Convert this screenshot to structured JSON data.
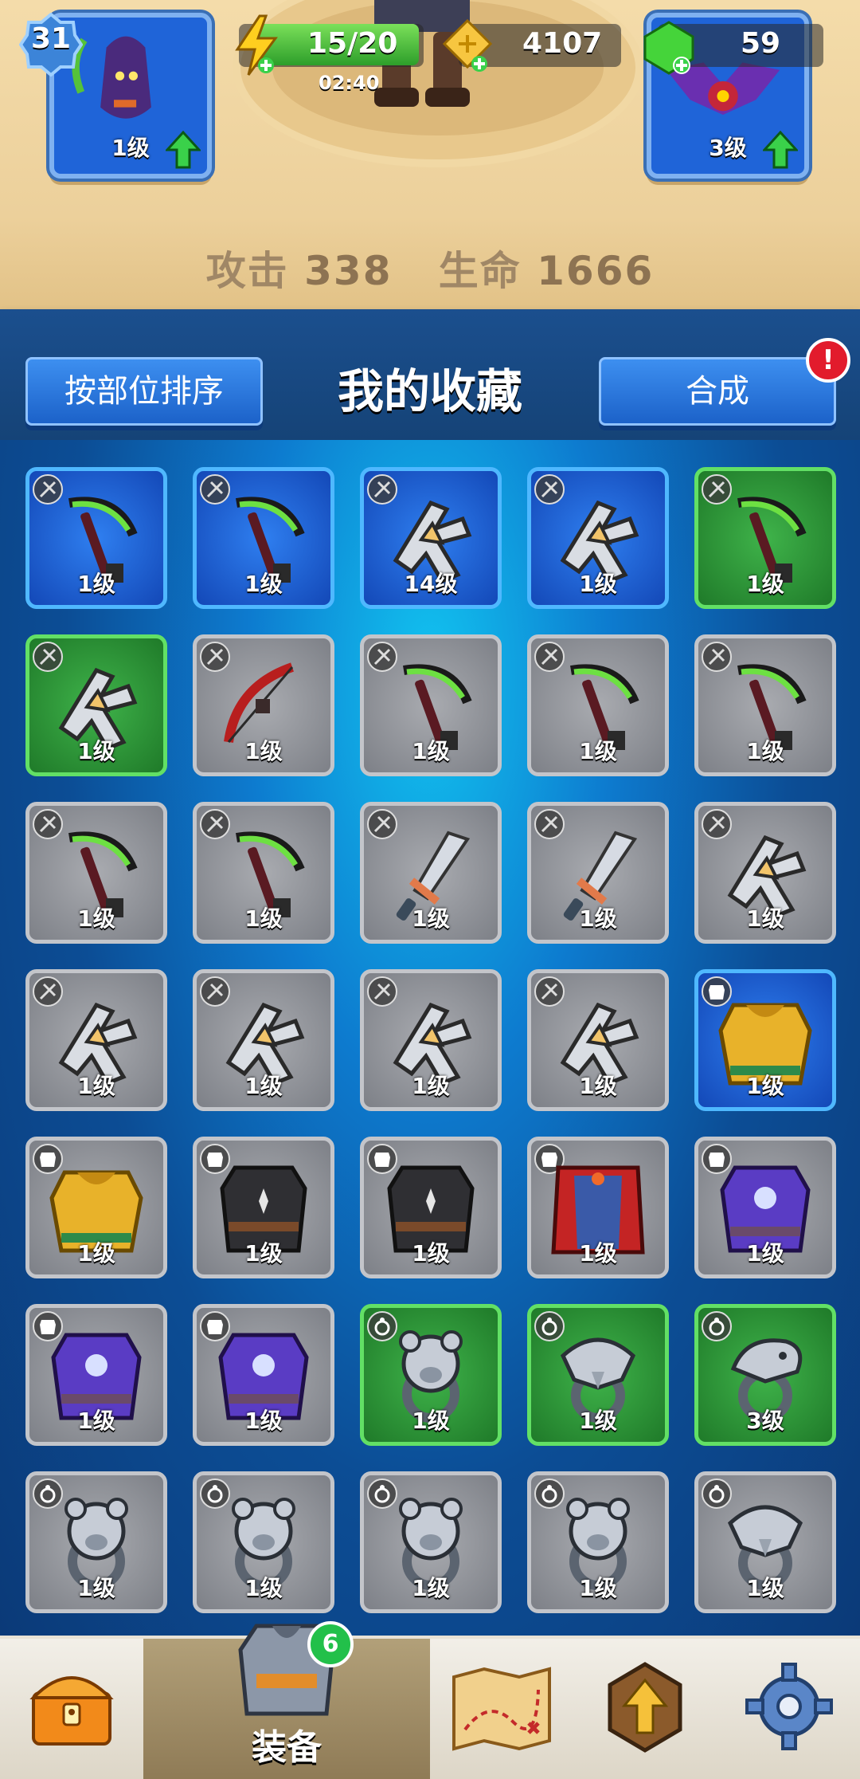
{
  "hud": {
    "player_level": "31",
    "energy": "15/20",
    "energy_timer": "02:40",
    "gold": "4107",
    "gems": "59"
  },
  "equipped": {
    "left_slot_level": "1级",
    "right_slot_level": "3级"
  },
  "stats": {
    "attack_label": "攻击",
    "attack_value": "338",
    "hp_label": "生命",
    "hp_value": "1666"
  },
  "header": {
    "sort_button": "按部位排序",
    "title": "我的收藏",
    "merge_button": "合成",
    "merge_alert": "!"
  },
  "items": [
    {
      "type": "scythe",
      "rarity": "blue",
      "category": "weapon",
      "level": "1级"
    },
    {
      "type": "scythe",
      "rarity": "blue",
      "category": "weapon",
      "level": "1级"
    },
    {
      "type": "shuriken",
      "rarity": "blue",
      "category": "weapon",
      "level": "14级"
    },
    {
      "type": "shuriken",
      "rarity": "blue",
      "category": "weapon",
      "level": "1级"
    },
    {
      "type": "scythe",
      "rarity": "green",
      "category": "weapon",
      "level": "1级"
    },
    {
      "type": "shuriken",
      "rarity": "green",
      "category": "weapon",
      "level": "1级"
    },
    {
      "type": "bow",
      "rarity": "gray",
      "category": "weapon",
      "level": "1级"
    },
    {
      "type": "scythe",
      "rarity": "gray",
      "category": "weapon",
      "level": "1级"
    },
    {
      "type": "scythe",
      "rarity": "gray",
      "category": "weapon",
      "level": "1级"
    },
    {
      "type": "scythe",
      "rarity": "gray",
      "category": "weapon",
      "level": "1级"
    },
    {
      "type": "scythe",
      "rarity": "gray",
      "category": "weapon",
      "level": "1级"
    },
    {
      "type": "scythe",
      "rarity": "gray",
      "category": "weapon",
      "level": "1级"
    },
    {
      "type": "sword",
      "rarity": "gray",
      "category": "weapon",
      "level": "1级"
    },
    {
      "type": "sword",
      "rarity": "gray",
      "category": "weapon",
      "level": "1级"
    },
    {
      "type": "shuriken",
      "rarity": "gray",
      "category": "weapon",
      "level": "1级"
    },
    {
      "type": "shuriken",
      "rarity": "gray",
      "category": "weapon",
      "level": "1级"
    },
    {
      "type": "shuriken",
      "rarity": "gray",
      "category": "weapon",
      "level": "1级"
    },
    {
      "type": "shuriken",
      "rarity": "gray",
      "category": "weapon",
      "level": "1级"
    },
    {
      "type": "shuriken",
      "rarity": "gray",
      "category": "weapon",
      "level": "1级"
    },
    {
      "type": "gold-armor",
      "rarity": "blue",
      "category": "armor",
      "level": "1级"
    },
    {
      "type": "gold-armor",
      "rarity": "gray",
      "category": "armor",
      "level": "1级"
    },
    {
      "type": "dark-vest",
      "rarity": "gray",
      "category": "armor",
      "level": "1级"
    },
    {
      "type": "dark-vest",
      "rarity": "gray",
      "category": "armor",
      "level": "1级"
    },
    {
      "type": "red-cloak",
      "rarity": "gray",
      "category": "armor",
      "level": "1级"
    },
    {
      "type": "purple-robe",
      "rarity": "gray",
      "category": "armor",
      "level": "1级"
    },
    {
      "type": "purple-robe",
      "rarity": "gray",
      "category": "armor",
      "level": "1级"
    },
    {
      "type": "purple-robe",
      "rarity": "gray",
      "category": "armor",
      "level": "1级"
    },
    {
      "type": "bear-ring",
      "rarity": "green",
      "category": "ring",
      "level": "1级"
    },
    {
      "type": "eagle-ring",
      "rarity": "green",
      "category": "ring",
      "level": "1级"
    },
    {
      "type": "snake-ring",
      "rarity": "green",
      "category": "ring",
      "level": "3级"
    },
    {
      "type": "bear-ring",
      "rarity": "gray",
      "category": "ring",
      "level": "1级"
    },
    {
      "type": "bear-ring",
      "rarity": "gray",
      "category": "ring",
      "level": "1级"
    },
    {
      "type": "bear-ring",
      "rarity": "gray",
      "category": "ring",
      "level": "1级"
    },
    {
      "type": "bear-ring",
      "rarity": "gray",
      "category": "ring",
      "level": "1级"
    },
    {
      "type": "eagle-ring",
      "rarity": "gray",
      "category": "ring",
      "level": "1级"
    }
  ],
  "nav": {
    "equipment_label": "装备",
    "equipment_badge": "6",
    "tabs": [
      "chest-icon",
      "equipment-icon",
      "map-icon",
      "upgrade-icon",
      "settings-icon"
    ]
  },
  "colors": {
    "rarity_gray": "#9a9ca1",
    "rarity_blue": "#1f5fd0",
    "rarity_green": "#2e9a38",
    "title_text": "#ffffff",
    "stat_text": "#a08766"
  }
}
